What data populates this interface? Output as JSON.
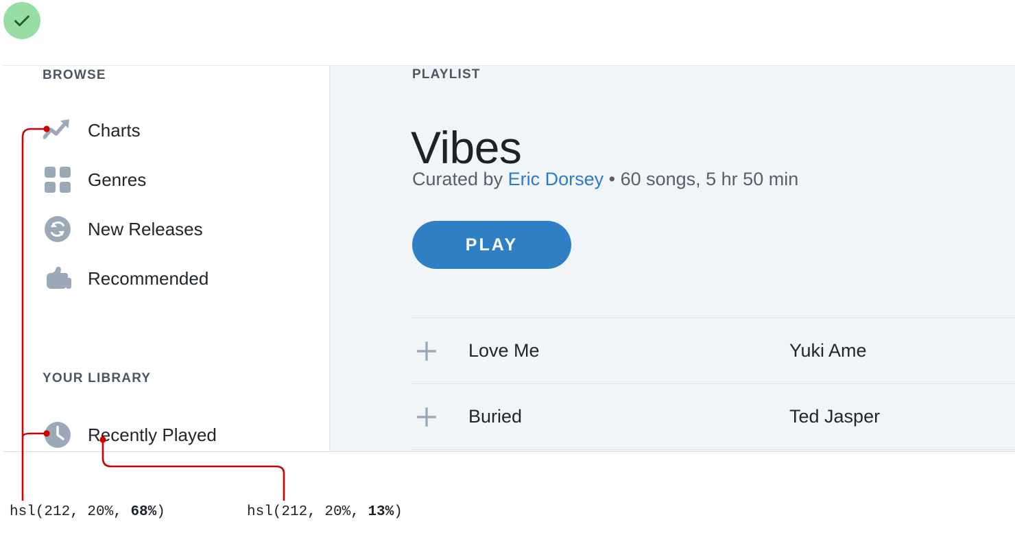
{
  "badge": {
    "icon": "check-icon",
    "color": "#97DDA4",
    "check_color": "#1F5C2E"
  },
  "sidebar": {
    "sections": [
      {
        "title": "BROWSE",
        "items": [
          {
            "label": "Charts",
            "icon": "trending-up-icon"
          },
          {
            "label": "Genres",
            "icon": "grid-icon"
          },
          {
            "label": "New Releases",
            "icon": "refresh-circle-icon"
          },
          {
            "label": "Recommended",
            "icon": "thumbs-up-icon"
          }
        ]
      },
      {
        "title": "YOUR LIBRARY",
        "items": [
          {
            "label": "Recently Played",
            "icon": "clock-icon"
          }
        ]
      }
    ]
  },
  "content": {
    "eyebrow": "PLAYLIST",
    "title": "Vibes",
    "meta": {
      "prefix": "Curated by ",
      "author": "Eric Dorsey",
      "suffix": " • 60 songs, 5 hr 50 min"
    },
    "play_label": "PLAY",
    "tracks": [
      {
        "add_icon": "plus-icon",
        "title": "Love Me",
        "artist": "Yuki Ame"
      },
      {
        "add_icon": "plus-icon",
        "title": "Buried",
        "artist": "Ted Jasper"
      }
    ]
  },
  "annotations": {
    "color": "#CC0000",
    "icon_color": {
      "prefix": "hsl(212, 20%, ",
      "value": "68%",
      "suffix": ")"
    },
    "text_color": {
      "prefix": "hsl(212, 20%, ",
      "value": "13%",
      "suffix": ")"
    }
  },
  "colors": {
    "icon_muted": "#9BA9B9",
    "text_dark": "#1B2026",
    "accent_blue": "#2E7FC4",
    "link_blue": "#2B7CC4",
    "panel_bg": "#F1F5F8",
    "section_header": "#4C5663"
  }
}
